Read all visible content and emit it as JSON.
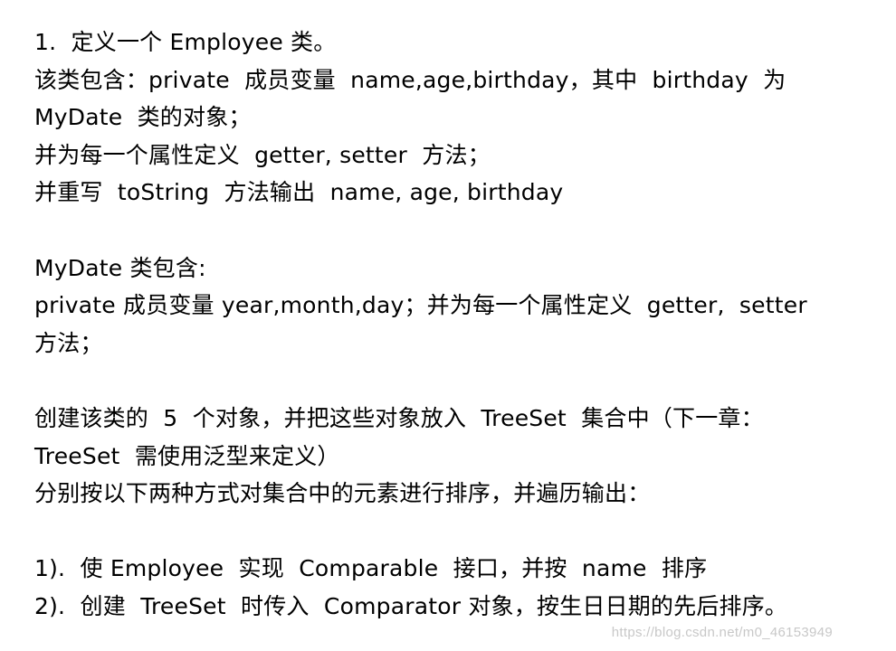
{
  "document": {
    "section_title": "1.  定义一个 Employee 类。",
    "employee_desc": [
      "该类包含：private  成员变量  name,age,birthday，其中  birthday  为",
      "MyDate  类的对象；",
      "并为每一个属性定义  getter, setter  方法；",
      "并重写  toString  方法输出  name, age, birthday"
    ],
    "mydate_desc": [
      "MyDate 类包含:",
      "private 成员变量 year,month,day；并为每一个属性定义  getter,  setter",
      "方法；"
    ],
    "task_desc": [
      "创建该类的  5  个对象，并把这些对象放入  TreeSet  集合中（下一章：",
      "TreeSet  需使用泛型来定义）",
      "分别按以下两种方式对集合中的元素进行排序，并遍历输出："
    ],
    "requirements": [
      "1).  使 Employee  实现  Comparable  接口，并按  name  排序",
      "2).  创建  TreeSet  时传入  Comparator 对象，按生日日期的先后排序。"
    ]
  },
  "watermark": "https://blog.csdn.net/m0_46153949"
}
